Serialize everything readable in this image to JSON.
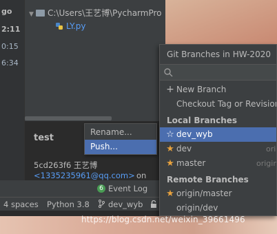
{
  "gutter": {
    "lines": [
      "go",
      "2:11",
      "0:15",
      "6:34"
    ]
  },
  "tree": {
    "folder_path": "C:\\Users\\王艺博\\PycharmPro",
    "file_name": "LY.py"
  },
  "commit_details": {
    "title": "test",
    "hash_author": "5cd263f6 王艺博",
    "email": "<1335235961@qq.com>",
    "on": "on"
  },
  "context_menu": {
    "items": [
      "Rename...",
      "Push..."
    ],
    "selected": "Push..."
  },
  "status": {
    "event_badge": "6",
    "event_log": "Event Log",
    "indent": "4 spaces",
    "interpreter": "Python 3.8",
    "branch": "dev_wyb"
  },
  "git_branches": {
    "title": "Git Branches in HW-2020",
    "actions": [
      "New Branch",
      "Checkout Tag or Revision"
    ],
    "local_header": "Local Branches",
    "local": [
      {
        "name": "dev_wyb",
        "trail": ""
      },
      {
        "name": "dev",
        "trail": "ori"
      },
      {
        "name": "master",
        "trail": "origin"
      }
    ],
    "remote_header": "Remote Branches",
    "remote": [
      "origin/master",
      "origin/dev"
    ]
  },
  "watermark": "https://blog.csdn.net/weixin_39661496",
  "colors": {
    "selection": "#4b6eaf",
    "star": "#e8a23e",
    "link": "#589df6",
    "badge": "#499c54"
  }
}
